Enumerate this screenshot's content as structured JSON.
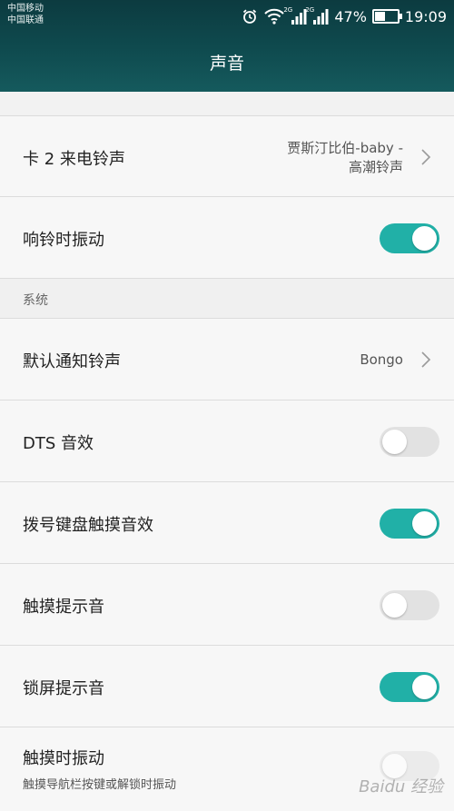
{
  "status_bar": {
    "carrier_1": "中国移动",
    "carrier_2": "中国联通",
    "network_1": "2G",
    "network_2": "2G",
    "battery_text": "47%",
    "battery_level": 0.47,
    "time": "19:09",
    "icons": [
      "alarm-icon",
      "wifi-icon",
      "signal-icon",
      "signal-icon",
      "battery-icon"
    ]
  },
  "header": {
    "title": "声音"
  },
  "accent_color": "#21b0a7",
  "rows": {
    "sim2_ringtone": {
      "title": "卡 2 来电铃声",
      "value_line1": "贾斯汀比伯-baby -",
      "value_line2": "高潮铃声"
    },
    "vibrate_on_ring": {
      "title": "响铃时振动",
      "toggle_on": true
    },
    "system_header": "系统",
    "default_notification": {
      "title": "默认通知铃声",
      "value": "Bongo"
    },
    "dts": {
      "title": "DTS 音效",
      "toggle_on": false
    },
    "dialpad_sound": {
      "title": "拨号键盘触摸音效",
      "toggle_on": true
    },
    "touch_sound": {
      "title": "触摸提示音",
      "toggle_on": false
    },
    "lock_sound": {
      "title": "锁屏提示音",
      "toggle_on": true
    },
    "touch_vibrate": {
      "title": "触摸时振动",
      "subtitle": "触摸导航栏按键或解锁时振动",
      "toggle_on": false
    }
  },
  "watermark": "Baidu 经验"
}
